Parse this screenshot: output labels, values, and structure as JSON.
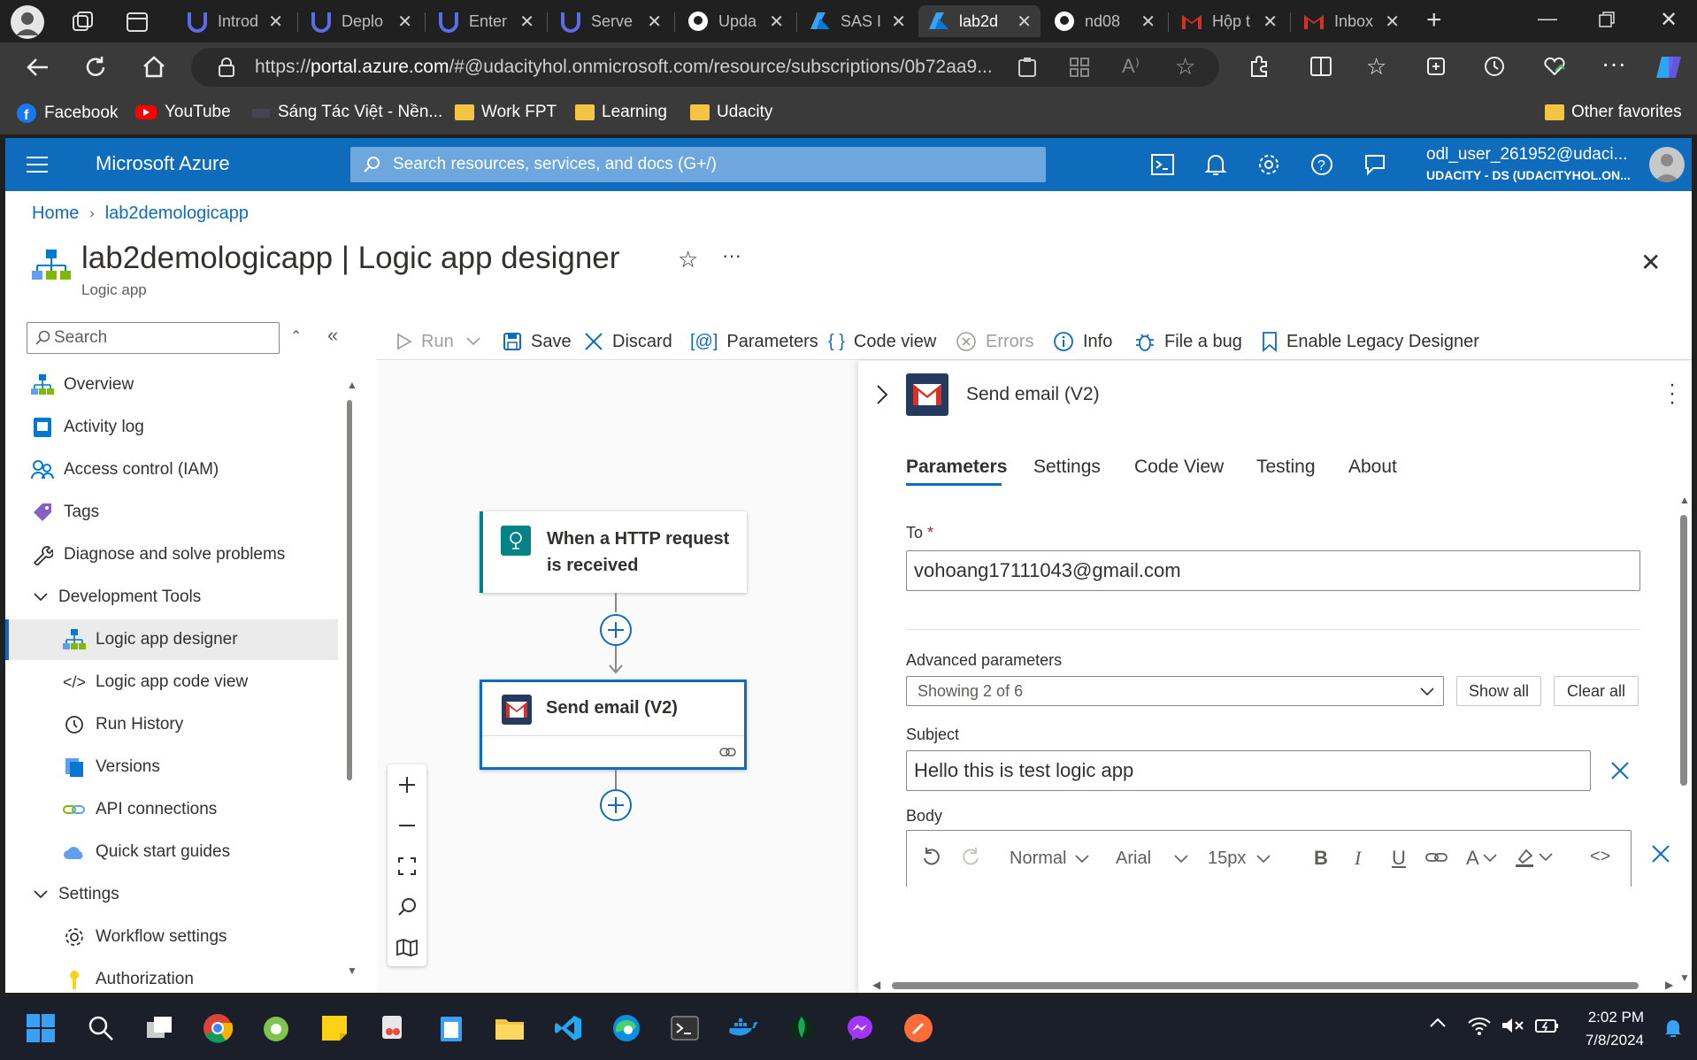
{
  "browser": {
    "tabs": [
      {
        "label": "Introd",
        "icon": "udacity-icon"
      },
      {
        "label": "Deplo",
        "icon": "udacity-icon"
      },
      {
        "label": "Enter",
        "icon": "udacity-icon"
      },
      {
        "label": "Serve",
        "icon": "udacity-icon"
      },
      {
        "label": "Upda",
        "icon": "github-icon"
      },
      {
        "label": "SAS I",
        "icon": "azure-icon"
      },
      {
        "label": "lab2d",
        "icon": "azure-icon"
      },
      {
        "label": "nd08",
        "icon": "github-icon"
      },
      {
        "label": "Hộp t",
        "icon": "gmail-icon"
      },
      {
        "label": "Inbox",
        "icon": "gmail-icon"
      }
    ],
    "url_prefix": "https://",
    "url_host": "portal.azure.com",
    "url_path": "/#@udacityhol.onmicrosoft.com/resource/subscriptions/0b72aa9...",
    "bookmarks": [
      "Facebook",
      "YouTube",
      "Sáng Tác Việt - Nền...",
      "Work FPT",
      "Learning",
      "Udacity"
    ],
    "other_favorites": "Other favorites"
  },
  "azure": {
    "brand": "Microsoft Azure",
    "search_placeholder": "Search resources, services, and docs (G+/)",
    "user_name": "odl_user_261952@udaci...",
    "user_tenant": "UDACITY - DS (UDACITYHOL.ON..."
  },
  "breadcrumb": {
    "home": "Home",
    "resource": "lab2demologicapp"
  },
  "page": {
    "title": "lab2demologicapp | Logic app designer",
    "subtitle": "Logic app"
  },
  "sidebar": {
    "search_placeholder": "Search",
    "items": [
      {
        "label": "Overview"
      },
      {
        "label": "Activity log"
      },
      {
        "label": "Access control (IAM)"
      },
      {
        "label": "Tags"
      },
      {
        "label": "Diagnose and solve problems"
      },
      {
        "label": "Development Tools"
      },
      {
        "label": "Logic app designer"
      },
      {
        "label": "Logic app code view"
      },
      {
        "label": "Run History"
      },
      {
        "label": "Versions"
      },
      {
        "label": "API connections"
      },
      {
        "label": "Quick start guides"
      },
      {
        "label": "Settings"
      },
      {
        "label": "Workflow settings"
      },
      {
        "label": "Authorization"
      }
    ]
  },
  "toolbar": {
    "run": "Run",
    "save": "Save",
    "discard": "Discard",
    "parameters": "Parameters",
    "code_view": "Code view",
    "errors": "Errors",
    "info": "Info",
    "file_bug": "File a bug",
    "legacy": "Enable Legacy Designer"
  },
  "workflow": {
    "trigger_line1": "When a HTTP request",
    "trigger_line2": "is received",
    "action": "Send email (V2)"
  },
  "panel": {
    "title": "Send email (V2)",
    "tabs": [
      "Parameters",
      "Settings",
      "Code View",
      "Testing",
      "About"
    ],
    "to_label": "To",
    "to_value": "vohoang17111043@gmail.com",
    "advanced_label": "Advanced parameters",
    "advanced_value": "Showing 2 of 6",
    "show_all": "Show all",
    "clear_all": "Clear all",
    "subject_label": "Subject",
    "subject_value": "Hello this is test logic app",
    "body_label": "Body",
    "format": "Normal",
    "font": "Arial",
    "size": "15px"
  },
  "taskbar": {
    "time": "2:02 PM",
    "date": "7/8/2024"
  },
  "colors": {
    "azure_blue": "#0f6cbd",
    "gmail_red": "#d93025",
    "trigger_teal": "#038387"
  }
}
